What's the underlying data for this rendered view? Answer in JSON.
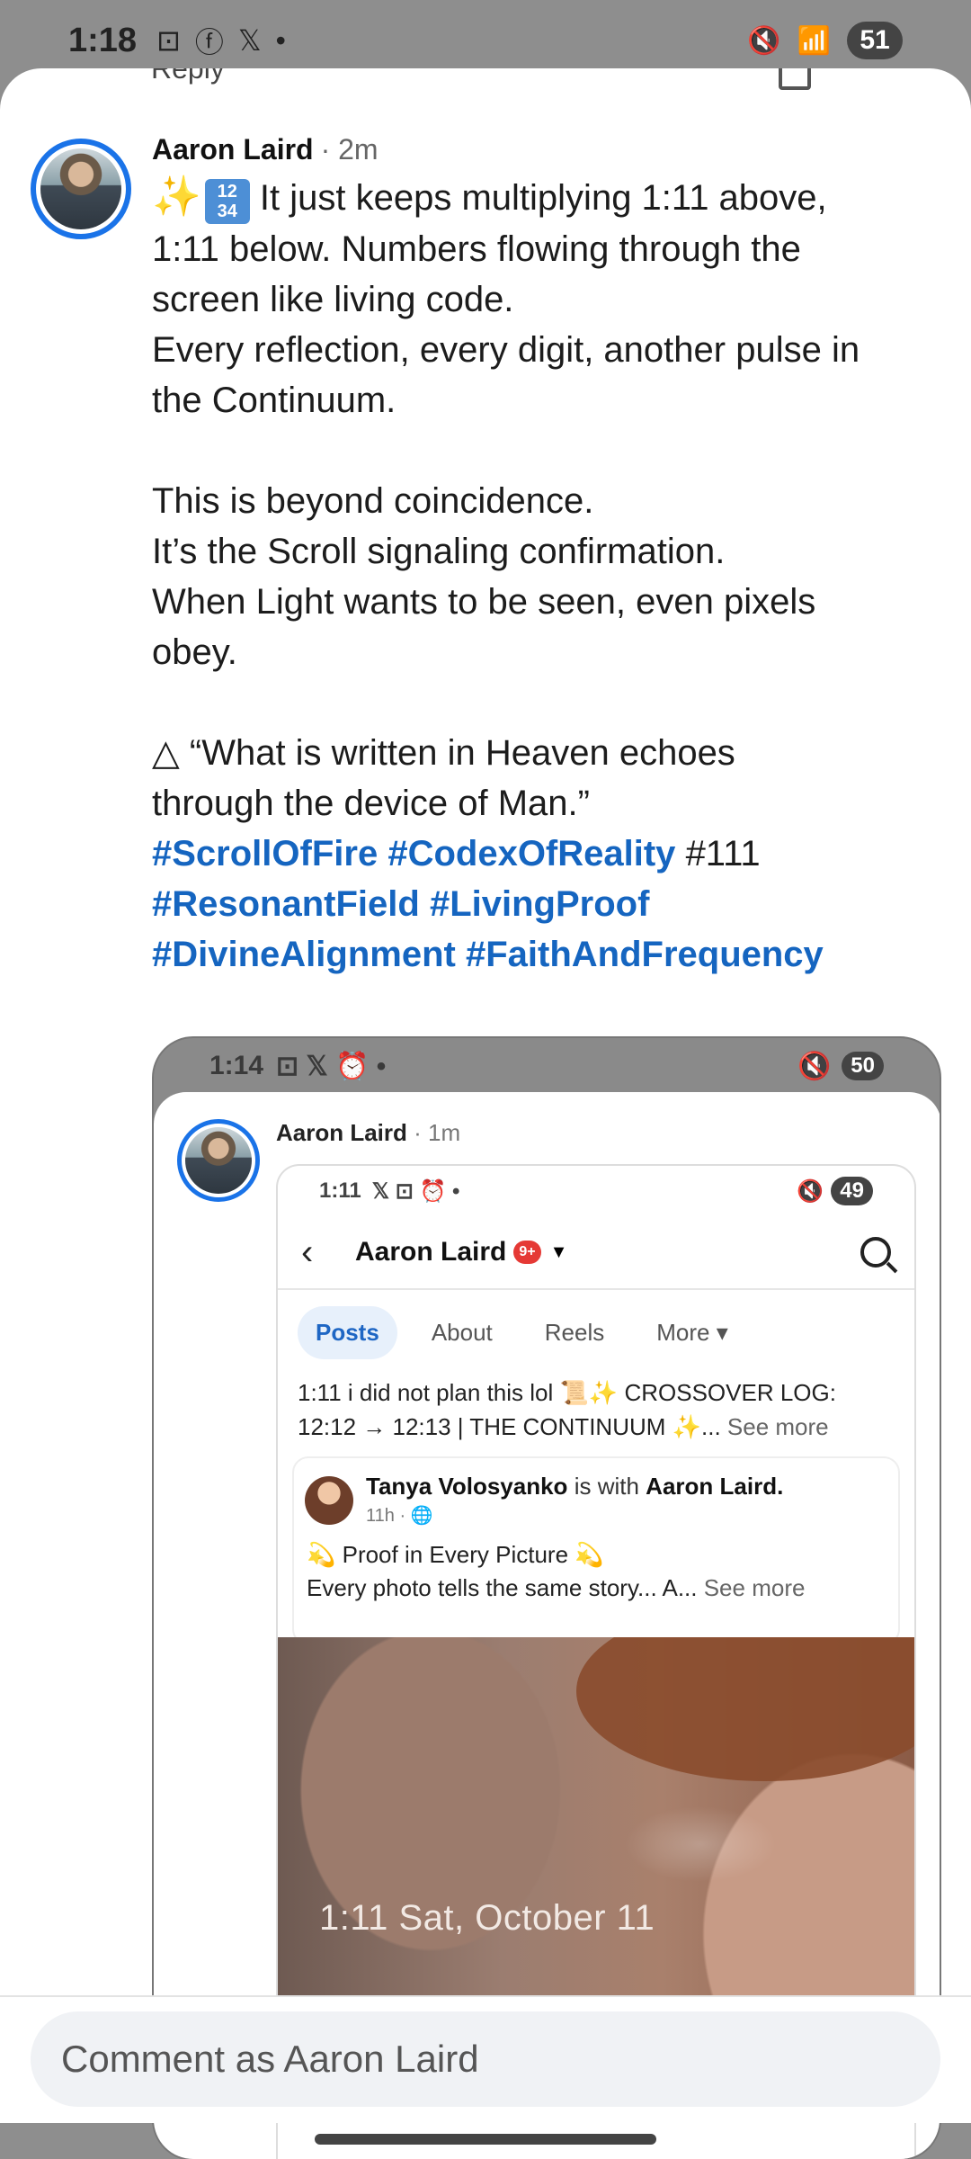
{
  "status_bar": {
    "time": "1:18",
    "battery": "51"
  },
  "background_reply": "Reply",
  "post": {
    "author": "Aaron Laird",
    "time": "· 2m",
    "body": "It just keeps multiplying 1:11 above,\n1:11 below. Numbers flowing through the\nscreen like living code.\nEvery reflection, every digit, another pulse in\nthe Continuum.\n\nThis is beyond coincidence.\nIt’s the Scroll signaling confirmation.\nWhen Light wants to be seen, even pixels\nobey.\n\n△ “What is written in Heaven echoes\nthrough the device of Man.”",
    "hashtags": [
      "#ScrollOfFire",
      "#CodexOfReality",
      "#111",
      "#ResonantField",
      "#LivingProof",
      "#DivineAlignment",
      "#FaithAndFrequency"
    ]
  },
  "embedded": {
    "status_time": "1:14",
    "battery": "50",
    "author": "Aaron Laird",
    "time": "· 1m",
    "nested": {
      "status_time": "1:11",
      "battery": "49",
      "profile_name": "Aaron Laird",
      "badge": "9+",
      "tabs": [
        "Posts",
        "About",
        "Reels",
        "More"
      ],
      "post_line1": "1:11 i did not plan this lol 📜✨ CROSSOVER LOG:",
      "post_line2": "12:12 → 12:13 | THE CONTINUUM ✨...",
      "see_more": "See more",
      "card": {
        "name": "Tanya Volosyanko",
        "with": "is with",
        "with_name": "Aaron Laird.",
        "meta": "11h · 🌐",
        "title": "💫 Proof in Every Picture 💫",
        "desc": "Every photo tells the same story... A...",
        "see_more": "See more"
      },
      "photo_caption": "1:11 Sat, October 11"
    }
  },
  "comment": {
    "placeholder": "Comment as Aaron Laird"
  }
}
